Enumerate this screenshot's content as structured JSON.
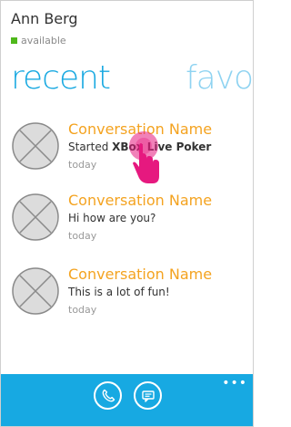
{
  "header": {
    "user_name": "Ann Berg",
    "status": "available",
    "status_color": "#4fb81b"
  },
  "pivots": [
    {
      "label": "recent",
      "color": "#19a9e1"
    },
    {
      "label": "favor",
      "color": "#8fd3f1"
    }
  ],
  "conversations": [
    {
      "name": "Conversation Name",
      "message_prefix": "Started ",
      "message_bold": "XBox Live Poker",
      "message": "",
      "time": "today"
    },
    {
      "name": "Conversation Name",
      "message_prefix": "",
      "message_bold": "",
      "message": "Hi how are you?",
      "time": "today"
    },
    {
      "name": "Conversation Name",
      "message_prefix": "",
      "message_bold": "",
      "message": "This is a lot of fun!",
      "time": "today"
    }
  ],
  "appbar": {
    "background": "#17a9e2",
    "more_label": "•••",
    "buttons": [
      {
        "icon": "phone-icon"
      },
      {
        "icon": "chat-icon"
      }
    ]
  },
  "accent_colors": {
    "conversation_title": "#f4a320",
    "touch_indicator": "#e6197f"
  }
}
